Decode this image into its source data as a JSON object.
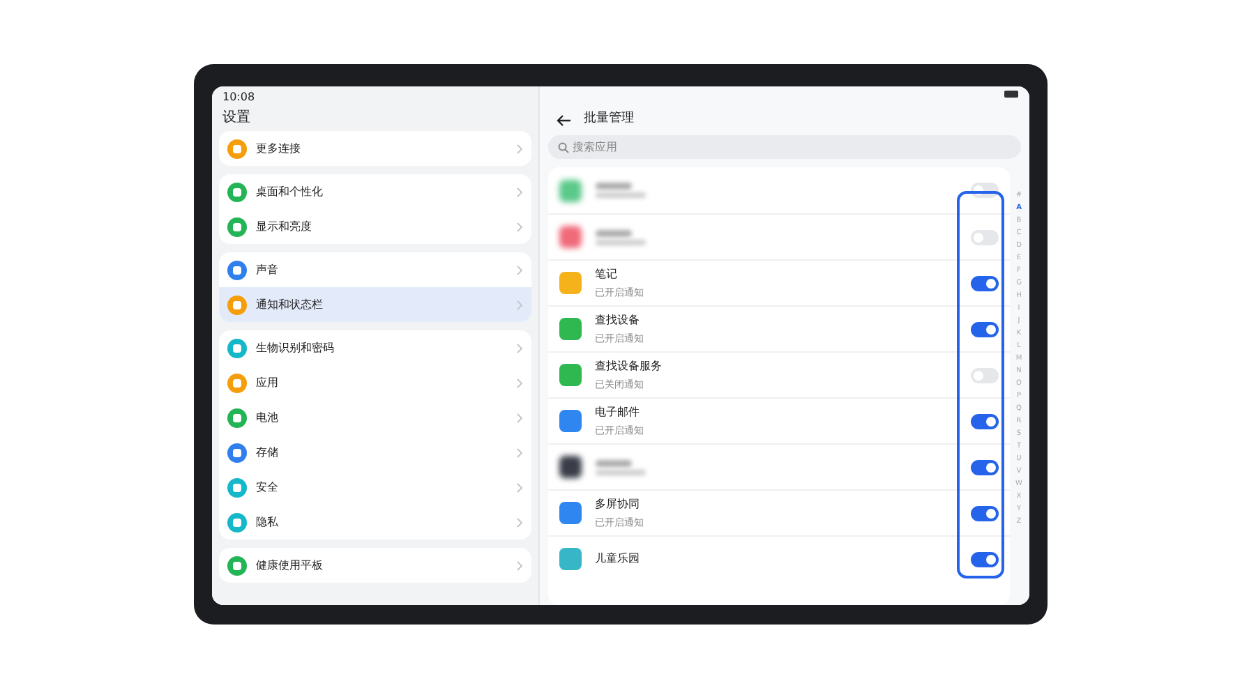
{
  "status_bar": {
    "time": "10:08"
  },
  "sidebar": {
    "title": "设置",
    "groups": [
      [
        {
          "label": "更多连接",
          "color": "#f59e0b",
          "selected": false
        }
      ],
      [
        {
          "label": "桌面和个性化",
          "color": "#22b455",
          "selected": false
        },
        {
          "label": "显示和亮度",
          "color": "#22b455",
          "selected": false
        }
      ],
      [
        {
          "label": "声音",
          "color": "#2f80ed",
          "selected": false
        },
        {
          "label": "通知和状态栏",
          "color": "#f59e0b",
          "selected": true
        }
      ],
      [
        {
          "label": "生物识别和密码",
          "color": "#14b8c8",
          "selected": false
        },
        {
          "label": "应用",
          "color": "#f59e0b",
          "selected": false
        },
        {
          "label": "电池",
          "color": "#22b455",
          "selected": false
        },
        {
          "label": "存储",
          "color": "#2f80ed",
          "selected": false
        },
        {
          "label": "安全",
          "color": "#14b8c8",
          "selected": false
        },
        {
          "label": "隐私",
          "color": "#14b8c8",
          "selected": false
        }
      ],
      [
        {
          "label": "健康使用平板",
          "color": "#22b455",
          "selected": false
        }
      ]
    ]
  },
  "detail": {
    "title": "批量管理",
    "search": {
      "placeholder": "搜索应用"
    },
    "apps": [
      {
        "kind": "blurred",
        "color": "#5bc98a",
        "on": false
      },
      {
        "kind": "blurred",
        "color": "#f06a7a",
        "on": false
      },
      {
        "kind": "app",
        "name": "笔记",
        "status": "已开启通知",
        "color": "#f5b21b",
        "on": true
      },
      {
        "kind": "app",
        "name": "查找设备",
        "status": "已开启通知",
        "color": "#2fb84f",
        "on": true
      },
      {
        "kind": "app",
        "name": "查找设备服务",
        "status": "已关闭通知",
        "color": "#2fb84f",
        "on": false
      },
      {
        "kind": "app",
        "name": "电子邮件",
        "status": "已开启通知",
        "color": "#2f86f0",
        "on": true
      },
      {
        "kind": "blurred",
        "color": "#3a3d48",
        "on": true
      },
      {
        "kind": "app",
        "name": "多屏协同",
        "status": "已开启通知",
        "color": "#2f86f0",
        "on": true
      },
      {
        "kind": "app",
        "name": "儿童乐园",
        "color": "#37b6c8",
        "on": true
      }
    ],
    "index": [
      {
        "label": "#",
        "selected": false
      },
      {
        "label": "A",
        "selected": true
      },
      {
        "label": "B",
        "selected": false
      },
      {
        "label": "C",
        "selected": false
      },
      {
        "label": "D",
        "selected": false
      },
      {
        "label": "E",
        "selected": false
      },
      {
        "label": "F",
        "selected": false
      },
      {
        "label": "G",
        "selected": false
      },
      {
        "label": "H",
        "selected": false
      },
      {
        "label": "I",
        "selected": false
      },
      {
        "label": "J",
        "selected": false
      },
      {
        "label": "K",
        "selected": false
      },
      {
        "label": "L",
        "selected": false
      },
      {
        "label": "M",
        "selected": false
      },
      {
        "label": "N",
        "selected": false
      },
      {
        "label": "O",
        "selected": false
      },
      {
        "label": "P",
        "selected": false
      },
      {
        "label": "Q",
        "selected": false
      },
      {
        "label": "R",
        "selected": false
      },
      {
        "label": "S",
        "selected": false
      },
      {
        "label": "T",
        "selected": false
      },
      {
        "label": "U",
        "selected": false
      },
      {
        "label": "V",
        "selected": false
      },
      {
        "label": "W",
        "selected": false
      },
      {
        "label": "X",
        "selected": false
      },
      {
        "label": "Y",
        "selected": false
      },
      {
        "label": "Z",
        "selected": false
      }
    ]
  }
}
